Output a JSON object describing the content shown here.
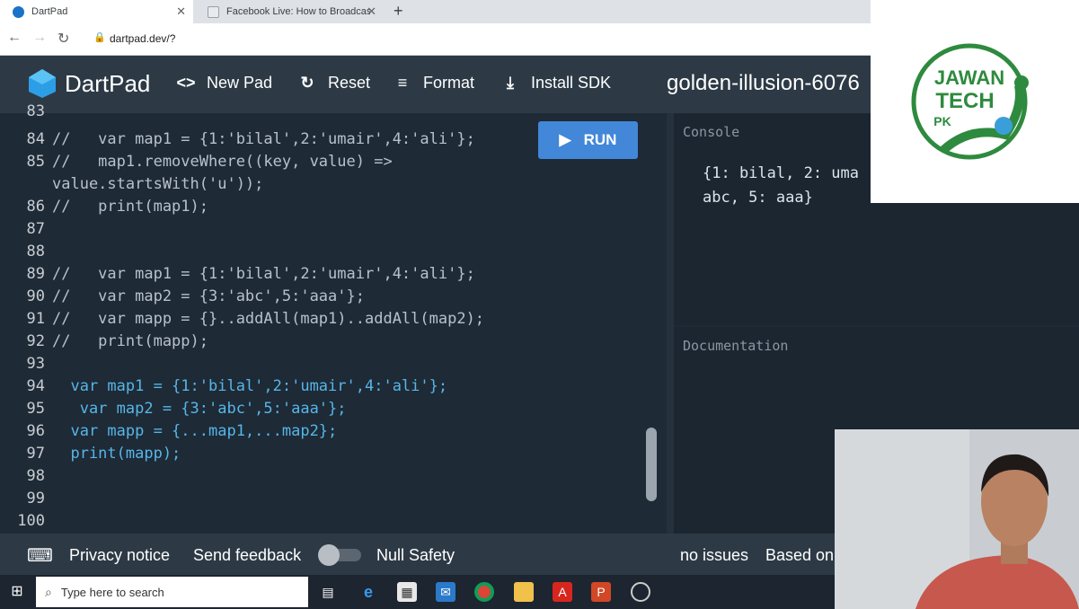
{
  "browser": {
    "tabs": [
      {
        "title": "DartPad",
        "active": true
      },
      {
        "title": "Facebook Live: How to Broadcas"
      }
    ],
    "url": "dartpad.dev/?"
  },
  "header": {
    "app_name": "DartPad",
    "new_pad": "New Pad",
    "reset": "Reset",
    "format": "Format",
    "install_sdk": "Install SDK",
    "pad_name": "golden-illusion-6076"
  },
  "run_label": "RUN",
  "editor": {
    "lines": [
      {
        "n": "84",
        "text": "//   var map1 = {1:'bilal',2:'umair',4:'ali'};"
      },
      {
        "n": "85",
        "text": "//   map1.removeWhere((key, value) =>"
      },
      {
        "n": "",
        "text": "value.startsWith('u'));"
      },
      {
        "n": "86",
        "text": "//   print(map1);"
      },
      {
        "n": "87",
        "text": ""
      },
      {
        "n": "88",
        "text": ""
      },
      {
        "n": "89",
        "text": "//   var map1 = {1:'bilal',2:'umair',4:'ali'};"
      },
      {
        "n": "90",
        "text": "//   var map2 = {3:'abc',5:'aaa'};"
      },
      {
        "n": "91",
        "text": "//   var mapp = {}..addAll(map1)..addAll(map2);"
      },
      {
        "n": "92",
        "text": "//   print(mapp);"
      },
      {
        "n": "93",
        "text": ""
      },
      {
        "n": "94",
        "text": "  var map1 = {1:'bilal',2:'umair',4:'ali'};"
      },
      {
        "n": "95",
        "text": "   var map2 = {3:'abc',5:'aaa'};"
      },
      {
        "n": "96",
        "text": "  var mapp = {...map1,...map2};"
      },
      {
        "n": "97",
        "text": "  print(mapp);"
      },
      {
        "n": "98",
        "text": ""
      },
      {
        "n": "99",
        "text": ""
      },
      {
        "n": "100",
        "text": ""
      }
    ]
  },
  "console": {
    "title": "Console",
    "output": "{1: bilal, 2: uma abc, 5: aaa}"
  },
  "documentation": {
    "title": "Documentation"
  },
  "footer": {
    "privacy": "Privacy notice",
    "feedback": "Send feedback",
    "null_safety": "Null Safety",
    "issues": "no issues",
    "based_on": "Based on"
  },
  "taskbar": {
    "search_placeholder": "Type here to search"
  },
  "overlay_logo": {
    "line1": "JAWAN",
    "line2": "TECH",
    "line3": "PK"
  },
  "colors": {
    "run_button": "#4287d8",
    "header_bg": "#2d3a46",
    "editor_bg": "#1e2a36"
  }
}
